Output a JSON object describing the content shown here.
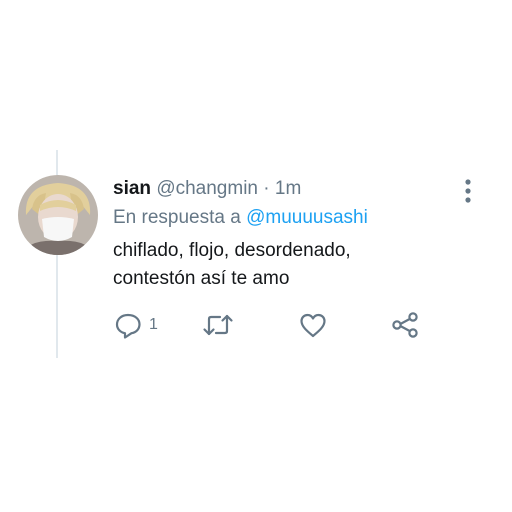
{
  "tweet": {
    "display_name": "sian",
    "handle": "@changmin",
    "separator": "·",
    "time": "1m",
    "reply_prefix": "En respuesta a",
    "reply_to": "@muuuusashi",
    "text_line1": "chiflado, flojo, desordenado,",
    "text_line2": "contestón así te amo",
    "reply_count": "1"
  },
  "icons": {
    "more": "more-vertical-icon",
    "reply": "reply-icon",
    "retweet": "retweet-icon",
    "like": "heart-icon",
    "share": "share-icon"
  },
  "colors": {
    "mention": "#1da1f2",
    "secondary_text": "#657786",
    "primary_text": "#14171a",
    "thread_line": "#e1e8ed"
  }
}
